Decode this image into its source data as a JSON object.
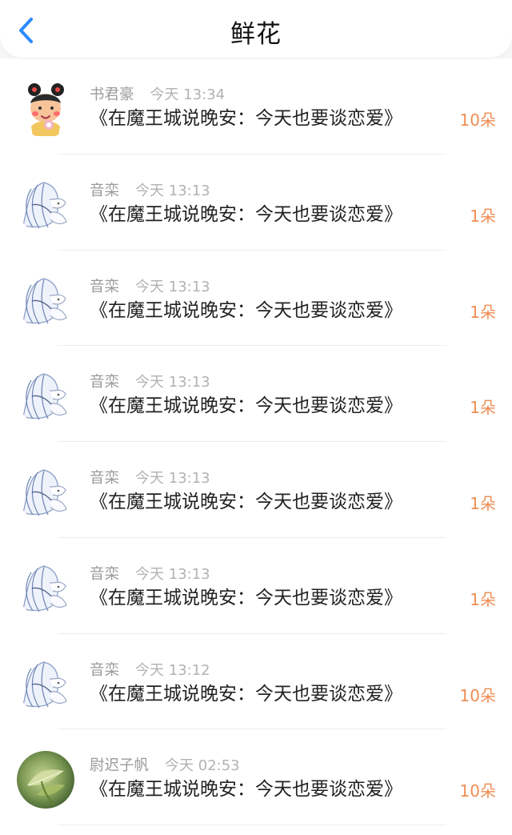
{
  "header": {
    "title": "鲜花",
    "back_icon": "back-chevron-icon",
    "accent_color": "#2b8cff"
  },
  "records": [
    {
      "user": "书君豪",
      "time": "今天 13:34",
      "book": "《在魔王城说晚安：今天也要谈恋爱》",
      "count": "10朵",
      "avatar_icon": "cartoon-girl-avatar-icon"
    },
    {
      "user": "音栾",
      "time": "今天 13:13",
      "book": "《在魔王城说晚安：今天也要谈恋爱》",
      "count": "1朵",
      "avatar_icon": "anime-sketch-avatar-icon"
    },
    {
      "user": "音栾",
      "time": "今天 13:13",
      "book": "《在魔王城说晚安：今天也要谈恋爱》",
      "count": "1朵",
      "avatar_icon": "anime-sketch-avatar-icon"
    },
    {
      "user": "音栾",
      "time": "今天 13:13",
      "book": "《在魔王城说晚安：今天也要谈恋爱》",
      "count": "1朵",
      "avatar_icon": "anime-sketch-avatar-icon"
    },
    {
      "user": "音栾",
      "time": "今天 13:13",
      "book": "《在魔王城说晚安：今天也要谈恋爱》",
      "count": "1朵",
      "avatar_icon": "anime-sketch-avatar-icon"
    },
    {
      "user": "音栾",
      "time": "今天 13:13",
      "book": "《在魔王城说晚安：今天也要谈恋爱》",
      "count": "1朵",
      "avatar_icon": "anime-sketch-avatar-icon"
    },
    {
      "user": "音栾",
      "time": "今天 13:12",
      "book": "《在魔王城说晚安：今天也要谈恋爱》",
      "count": "10朵",
      "avatar_icon": "anime-sketch-avatar-icon"
    },
    {
      "user": "尉迟子帆",
      "time": "今天 02:53",
      "book": "《在魔王城说晚安：今天也要谈恋爱》",
      "count": "10朵",
      "avatar_icon": "green-leaf-avatar-icon"
    }
  ],
  "colors": {
    "name": "#9b9b9b",
    "time": "#b2b2b2",
    "book": "#222222",
    "count": "#ef8d53"
  }
}
